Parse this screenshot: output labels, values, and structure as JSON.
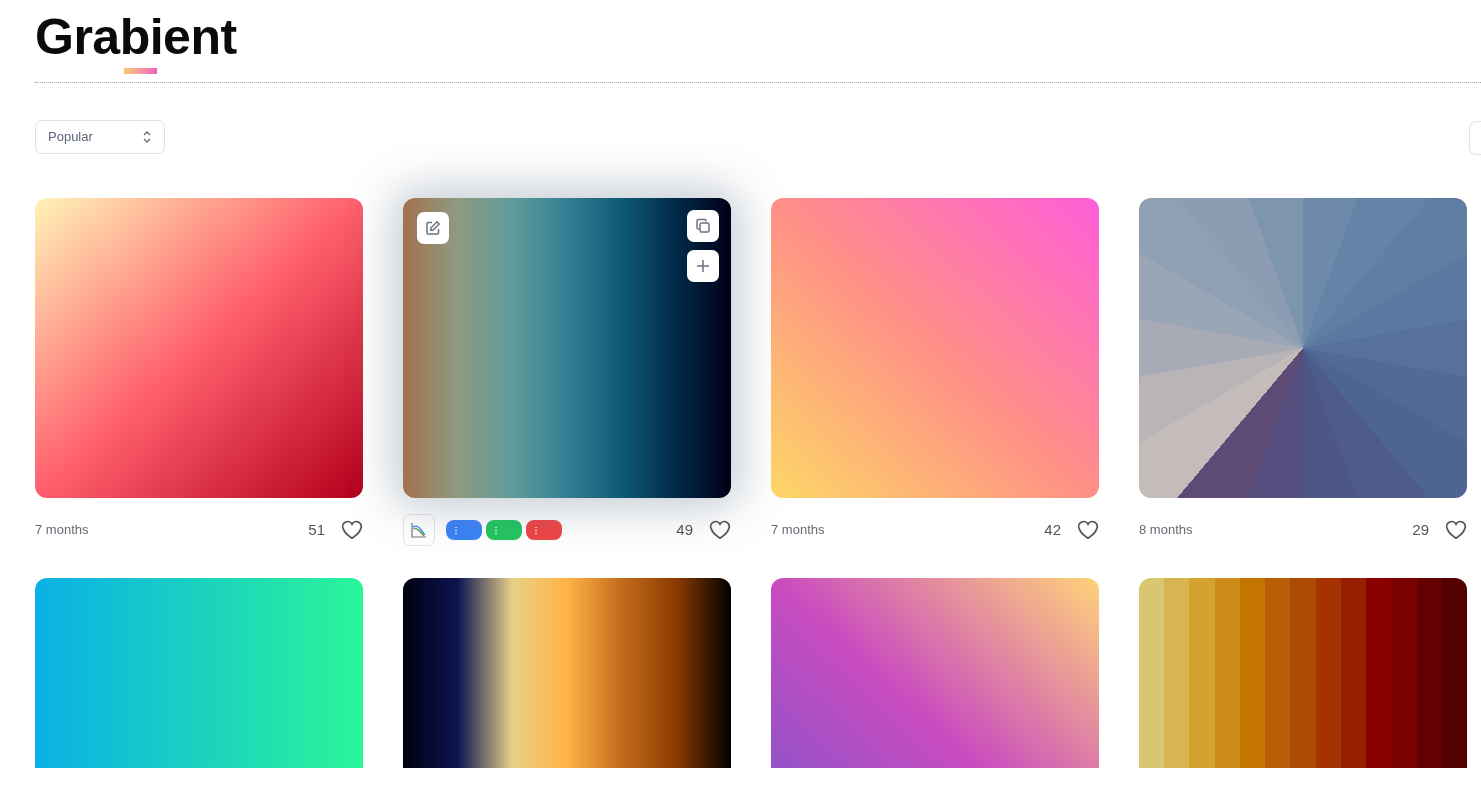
{
  "logo": {
    "text": "Grabient"
  },
  "sort": {
    "value": "Popular"
  },
  "cards": [
    {
      "age": "7 months",
      "likes": "51",
      "hovered": false
    },
    {
      "likes": "49",
      "hovered": true,
      "pills": [
        {
          "color": "#3b82f6"
        },
        {
          "color": "#22c55e"
        },
        {
          "color": "#ef4444"
        }
      ]
    },
    {
      "age": "7 months",
      "likes": "42",
      "hovered": false
    },
    {
      "age": "8 months",
      "likes": "29",
      "hovered": false
    },
    {
      "hovered": false
    },
    {
      "hovered": false
    },
    {
      "hovered": false
    },
    {
      "hovered": false
    }
  ]
}
